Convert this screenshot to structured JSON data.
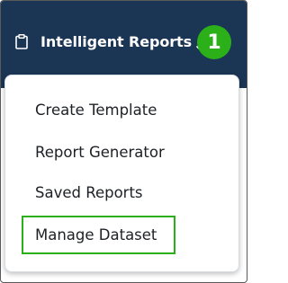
{
  "navbar": {
    "menu_label": "Intelligent Reports",
    "icons": {
      "menu_icon": "clipboard-icon",
      "expand_icon": "chevron-down-icon"
    },
    "step_badge": "1"
  },
  "dropdown": {
    "items": [
      {
        "label": "Create Template"
      },
      {
        "label": "Report Generator"
      },
      {
        "label": "Saved Reports"
      },
      {
        "label": "Manage Dataset",
        "highlighted": true
      }
    ]
  },
  "colors": {
    "navbar_bg": "#1b3654",
    "badge_green": "#2bb019",
    "highlight_border": "#2bb019",
    "text_dark": "#1d2026"
  }
}
